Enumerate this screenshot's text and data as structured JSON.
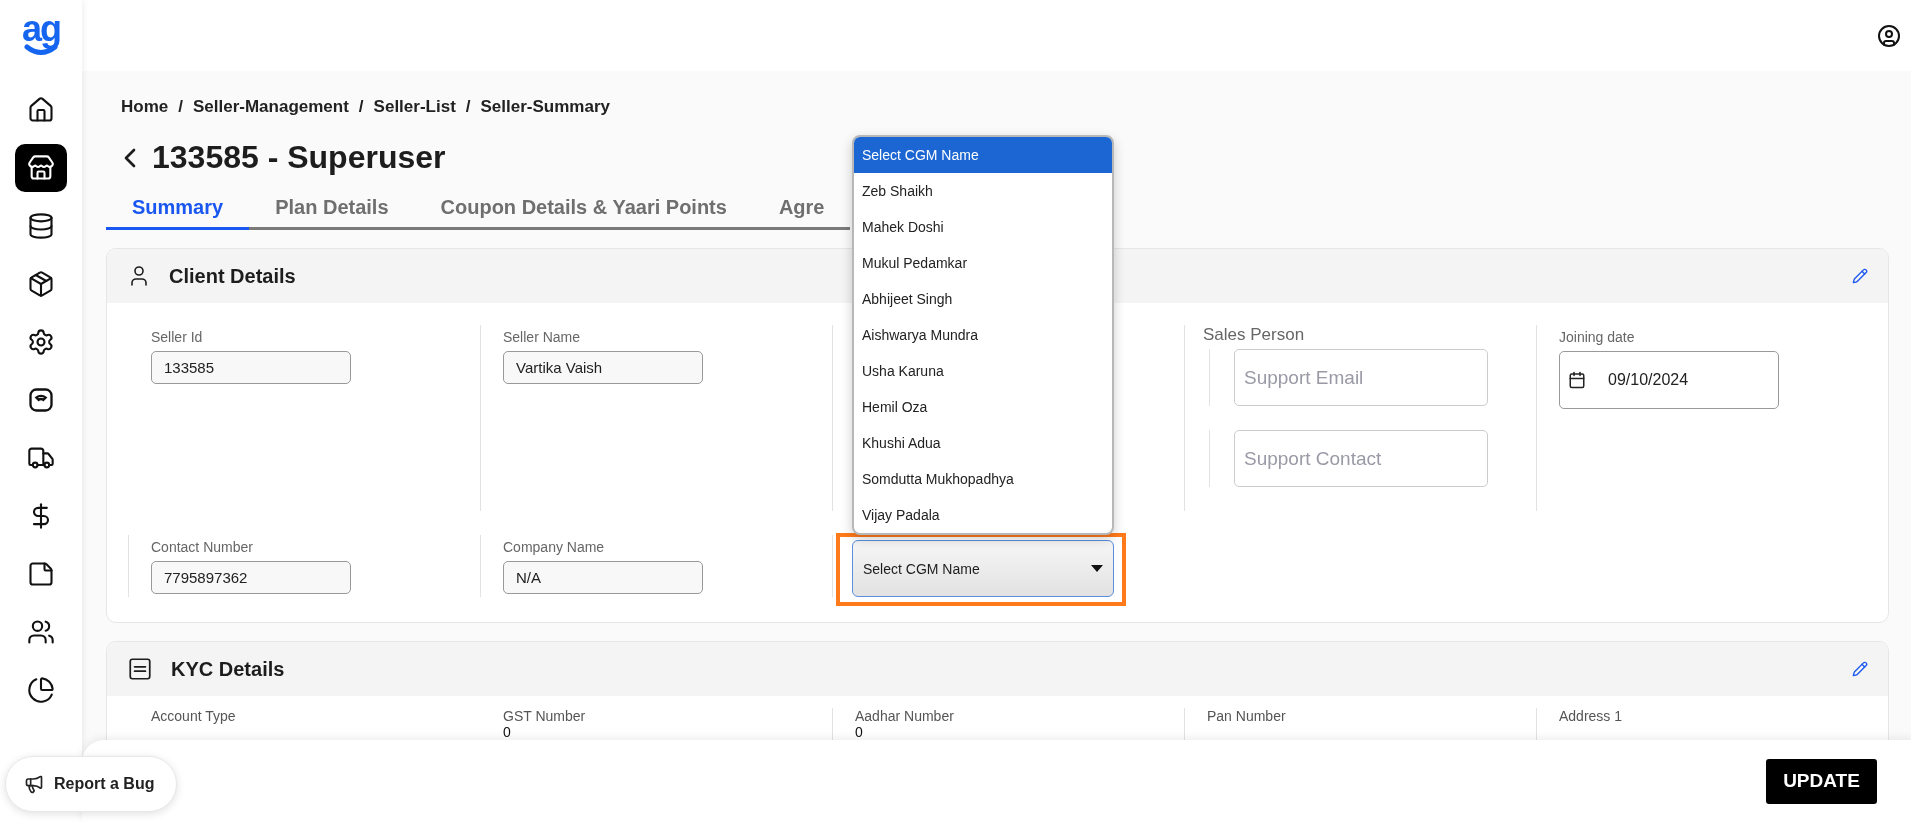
{
  "logo": "ag",
  "sidebar": {
    "items": [
      {
        "selected": false
      },
      {
        "selected": true
      },
      {
        "selected": false
      },
      {
        "selected": false
      },
      {
        "selected": false
      },
      {
        "selected": false
      },
      {
        "selected": false
      },
      {
        "selected": false
      },
      {
        "selected": false
      },
      {
        "selected": false
      },
      {
        "selected": false
      }
    ]
  },
  "breadcrumb": {
    "separator": "/",
    "items": [
      "Home",
      "Seller-Management",
      "Seller-List",
      "Seller-Summary"
    ]
  },
  "page_title": "133585 - Superuser",
  "tabs": [
    {
      "label": "Summary",
      "selected": true
    },
    {
      "label": "Plan Details",
      "selected": false
    },
    {
      "label": "Coupon Details & Yaari Points",
      "selected": false
    },
    {
      "label": "Agre",
      "selected": false
    }
  ],
  "client_details": {
    "title": "Client Details",
    "rows": [
      [
        {
          "kind": "text",
          "label": "Seller Id",
          "value": "133585"
        },
        {
          "kind": "text",
          "label": "Seller Name",
          "value": "Vartika Vaish"
        },
        {
          "kind": "covered"
        },
        {
          "kind": "sales_person",
          "label": "Sales Person",
          "placeholders": [
            "Support Email",
            "Support Contact"
          ]
        },
        {
          "kind": "date",
          "label": "Joining date",
          "value": "09/10/2024"
        }
      ],
      [
        {
          "kind": "text",
          "label": "Contact Number",
          "value": "7795897362"
        },
        {
          "kind": "text",
          "label": "Company Name",
          "value": "N/A"
        },
        {
          "kind": "select",
          "value": "Select CGM Name",
          "expanded": true,
          "highlighted": true,
          "options": [
            {
              "label": "Select CGM Name",
              "selected": true
            },
            {
              "label": "Zeb Shaikh",
              "selected": false
            },
            {
              "label": "Mahek Doshi",
              "selected": false
            },
            {
              "label": "Mukul Pedamkar",
              "selected": false
            },
            {
              "label": "Abhijeet Singh",
              "selected": false
            },
            {
              "label": "Aishwarya Mundra",
              "selected": false
            },
            {
              "label": "Usha Karuna",
              "selected": false
            },
            {
              "label": "Hemil Oza",
              "selected": false
            },
            {
              "label": "Khushi Adua",
              "selected": false
            },
            {
              "label": "Somdutta Mukhopadhya",
              "selected": false
            },
            {
              "label": "Vijay Padala",
              "selected": false
            }
          ]
        }
      ]
    ]
  },
  "kyc_details": {
    "title": "KYC Details",
    "fields": [
      {
        "label": "Account Type"
      },
      {
        "label": "GST Number",
        "value": "0"
      },
      {
        "label": "Aadhar Number",
        "value": "0"
      },
      {
        "label": "Pan Number"
      },
      {
        "label": "Address 1"
      }
    ]
  },
  "report_bug": "Report a Bug",
  "update_button": "UPDATE"
}
